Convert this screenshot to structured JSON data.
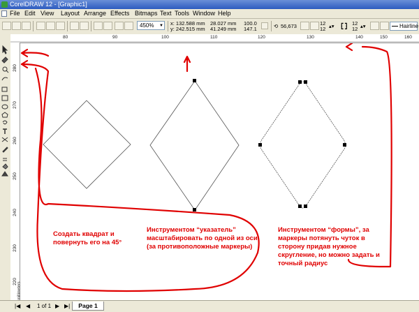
{
  "window": {
    "title": "CorelDRAW 12 - [Graphic1]"
  },
  "menu": [
    "File",
    "Edit",
    "View",
    "Layout",
    "Arrange",
    "Effects",
    "Bitmaps",
    "Text",
    "Tools",
    "Window",
    "Help"
  ],
  "toolbar": {
    "zoom": "450%",
    "x": "x: 132.588 mm",
    "y": "y: 242.515 mm",
    "w": "28.027 mm",
    "h": "41.249 mm",
    "scale_w": "100.0",
    "scale_h": "147.1",
    "angle": "56,673",
    "corner_tl": "12",
    "corner_bl": "12",
    "corner_tr": "12",
    "corner_br": "12",
    "outline": "Hairline"
  },
  "rulers": {
    "h_ticks": [
      "80",
      "90",
      "100",
      "110",
      "120",
      "130",
      "140",
      "150",
      "160"
    ],
    "v_ticks": [
      "280",
      "270",
      "260",
      "250",
      "240",
      "230",
      "220"
    ],
    "v_unit": "millimeters"
  },
  "annotations": {
    "left": "Создать квадрат и повернуть его на 45°",
    "middle": "Инструментом “указатель” масштабировать по одной из оси (за противоположные маркеры)",
    "right": "Инструментом “формы”, за маркеры потянуть чуток в сторону придав нужное скругление, но можно задать и точный радиус"
  },
  "pages": {
    "counter": "1 of 1",
    "tab": "Page 1"
  },
  "colors": {
    "annotation": "#e00000",
    "titlebar": "#2d5bbf"
  }
}
